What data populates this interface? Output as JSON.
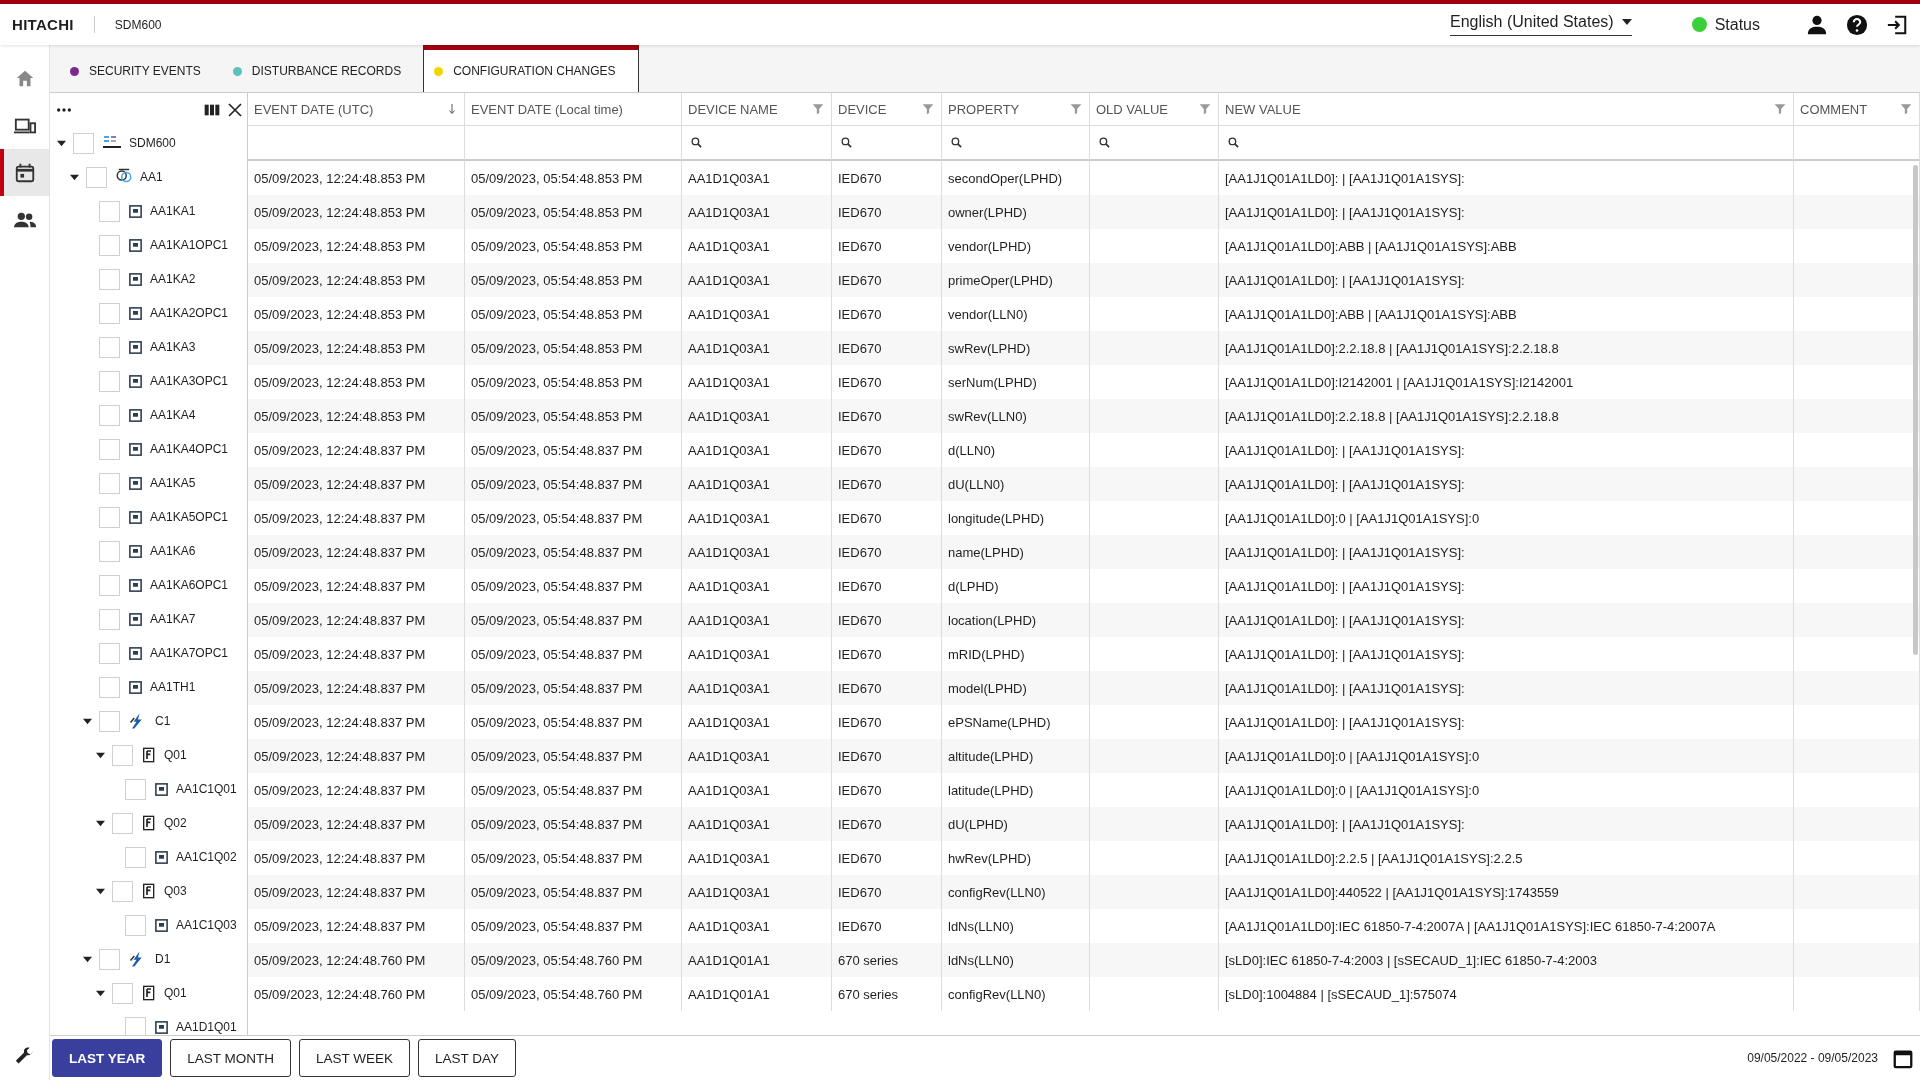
{
  "header": {
    "brand": "HITACHI",
    "product": "SDM600",
    "language": "English (United States)",
    "status": {
      "label": "Status",
      "color": "#3ccf3c"
    }
  },
  "nav": [
    {
      "kind": "home",
      "selected": false
    },
    {
      "kind": "devices",
      "selected": false
    },
    {
      "kind": "calendar",
      "selected": true
    },
    {
      "kind": "users",
      "selected": false
    }
  ],
  "tabs": [
    {
      "label": "SECURITY EVENTS",
      "color": "#7a2a8c",
      "selected": false
    },
    {
      "label": "DISTURBANCE RECORDS",
      "color": "#5cc0bb",
      "selected": false
    },
    {
      "label": "CONFIGURATION CHANGES",
      "color": "#f2d600",
      "selected": true
    }
  ],
  "tree": [
    {
      "label": "SDM600",
      "kind": "root",
      "checked": false,
      "expanded": true,
      "children": [
        {
          "label": "AA1",
          "kind": "substation",
          "checked": false,
          "expanded": true,
          "children": [
            {
              "label": "AA1KA1",
              "kind": "ied",
              "checked": false
            },
            {
              "label": "AA1KA1OPC1",
              "kind": "ied",
              "checked": false
            },
            {
              "label": "AA1KA2",
              "kind": "ied",
              "checked": false
            },
            {
              "label": "AA1KA2OPC1",
              "kind": "ied",
              "checked": false
            },
            {
              "label": "AA1KA3",
              "kind": "ied",
              "checked": false
            },
            {
              "label": "AA1KA3OPC1",
              "kind": "ied",
              "checked": false
            },
            {
              "label": "AA1KA4",
              "kind": "ied",
              "checked": false
            },
            {
              "label": "AA1KA4OPC1",
              "kind": "ied",
              "checked": false
            },
            {
              "label": "AA1KA5",
              "kind": "ied",
              "checked": false
            },
            {
              "label": "AA1KA5OPC1",
              "kind": "ied",
              "checked": false
            },
            {
              "label": "AA1KA6",
              "kind": "ied",
              "checked": false
            },
            {
              "label": "AA1KA6OPC1",
              "kind": "ied",
              "checked": false
            },
            {
              "label": "AA1KA7",
              "kind": "ied",
              "checked": false
            },
            {
              "label": "AA1KA7OPC1",
              "kind": "ied",
              "checked": false
            },
            {
              "label": "AA1TH1",
              "kind": "ied",
              "checked": false
            },
            {
              "label": "C1",
              "kind": "voltage",
              "checked": false,
              "expanded": true,
              "children": [
                {
                  "label": "Q01",
                  "kind": "bay",
                  "checked": false,
                  "expanded": true,
                  "children": [
                    {
                      "label": "AA1C1Q01",
                      "kind": "ied",
                      "checked": false
                    }
                  ]
                },
                {
                  "label": "Q02",
                  "kind": "bay",
                  "checked": false,
                  "expanded": true,
                  "children": [
                    {
                      "label": "AA1C1Q02",
                      "kind": "ied",
                      "checked": false
                    }
                  ]
                },
                {
                  "label": "Q03",
                  "kind": "bay",
                  "checked": false,
                  "expanded": true,
                  "children": [
                    {
                      "label": "AA1C1Q03",
                      "kind": "ied",
                      "checked": false
                    }
                  ]
                }
              ]
            },
            {
              "label": "D1",
              "kind": "voltage",
              "checked": false,
              "expanded": true,
              "children": [
                {
                  "label": "Q01",
                  "kind": "bay",
                  "checked": false,
                  "expanded": true,
                  "children": [
                    {
                      "label": "AA1D1Q01",
                      "kind": "ied",
                      "checked": false
                    }
                  ]
                }
              ]
            }
          ]
        }
      ]
    }
  ],
  "table": {
    "columns": [
      {
        "label": "EVENT DATE (UTC)",
        "sorted": true,
        "filter": false,
        "search": false
      },
      {
        "label": "EVENT DATE (Local time)",
        "sorted": false,
        "filter": false,
        "search": false
      },
      {
        "label": "DEVICE NAME",
        "sorted": false,
        "filter": true,
        "search": true
      },
      {
        "label": "DEVICE",
        "sorted": false,
        "filter": true,
        "search": true
      },
      {
        "label": "PROPERTY",
        "sorted": false,
        "filter": true,
        "search": true
      },
      {
        "label": "OLD VALUE",
        "sorted": false,
        "filter": true,
        "search": true
      },
      {
        "label": "NEW VALUE",
        "sorted": false,
        "filter": true,
        "search": true
      },
      {
        "label": "COMMENT",
        "sorted": false,
        "filter": true,
        "search": false
      }
    ],
    "rows": [
      {
        "utc": "05/09/2023, 12:24:48.853 PM",
        "local": "05/09/2023, 05:54:48.853 PM",
        "device_name": "AA1D1Q03A1",
        "device": "IED670",
        "property": "secondOper(LPHD)",
        "new_value": "[AA1J1Q01A1LD0]: | [AA1J1Q01A1SYS]:"
      },
      {
        "utc": "05/09/2023, 12:24:48.853 PM",
        "local": "05/09/2023, 05:54:48.853 PM",
        "device_name": "AA1D1Q03A1",
        "device": "IED670",
        "property": "owner(LPHD)",
        "new_value": "[AA1J1Q01A1LD0]: | [AA1J1Q01A1SYS]:"
      },
      {
        "utc": "05/09/2023, 12:24:48.853 PM",
        "local": "05/09/2023, 05:54:48.853 PM",
        "device_name": "AA1D1Q03A1",
        "device": "IED670",
        "property": "vendor(LPHD)",
        "new_value": "[AA1J1Q01A1LD0]:ABB | [AA1J1Q01A1SYS]:ABB"
      },
      {
        "utc": "05/09/2023, 12:24:48.853 PM",
        "local": "05/09/2023, 05:54:48.853 PM",
        "device_name": "AA1D1Q03A1",
        "device": "IED670",
        "property": "primeOper(LPHD)",
        "new_value": "[AA1J1Q01A1LD0]: | [AA1J1Q01A1SYS]:"
      },
      {
        "utc": "05/09/2023, 12:24:48.853 PM",
        "local": "05/09/2023, 05:54:48.853 PM",
        "device_name": "AA1D1Q03A1",
        "device": "IED670",
        "property": "vendor(LLN0)",
        "new_value": "[AA1J1Q01A1LD0]:ABB | [AA1J1Q01A1SYS]:ABB"
      },
      {
        "utc": "05/09/2023, 12:24:48.853 PM",
        "local": "05/09/2023, 05:54:48.853 PM",
        "device_name": "AA1D1Q03A1",
        "device": "IED670",
        "property": "swRev(LPHD)",
        "new_value": "[AA1J1Q01A1LD0]:2.2.18.8 | [AA1J1Q01A1SYS]:2.2.18.8"
      },
      {
        "utc": "05/09/2023, 12:24:48.853 PM",
        "local": "05/09/2023, 05:54:48.853 PM",
        "device_name": "AA1D1Q03A1",
        "device": "IED670",
        "property": "serNum(LPHD)",
        "new_value": "[AA1J1Q01A1LD0]:I2142001 | [AA1J1Q01A1SYS]:I2142001"
      },
      {
        "utc": "05/09/2023, 12:24:48.853 PM",
        "local": "05/09/2023, 05:54:48.853 PM",
        "device_name": "AA1D1Q03A1",
        "device": "IED670",
        "property": "swRev(LLN0)",
        "new_value": "[AA1J1Q01A1LD0]:2.2.18.8 | [AA1J1Q01A1SYS]:2.2.18.8"
      },
      {
        "utc": "05/09/2023, 12:24:48.837 PM",
        "local": "05/09/2023, 05:54:48.837 PM",
        "device_name": "AA1D1Q03A1",
        "device": "IED670",
        "property": "d(LLN0)",
        "new_value": "[AA1J1Q01A1LD0]: | [AA1J1Q01A1SYS]:"
      },
      {
        "utc": "05/09/2023, 12:24:48.837 PM",
        "local": "05/09/2023, 05:54:48.837 PM",
        "device_name": "AA1D1Q03A1",
        "device": "IED670",
        "property": "dU(LLN0)",
        "new_value": "[AA1J1Q01A1LD0]: | [AA1J1Q01A1SYS]:"
      },
      {
        "utc": "05/09/2023, 12:24:48.837 PM",
        "local": "05/09/2023, 05:54:48.837 PM",
        "device_name": "AA1D1Q03A1",
        "device": "IED670",
        "property": "longitude(LPHD)",
        "new_value": "[AA1J1Q01A1LD0]:0 | [AA1J1Q01A1SYS]:0"
      },
      {
        "utc": "05/09/2023, 12:24:48.837 PM",
        "local": "05/09/2023, 05:54:48.837 PM",
        "device_name": "AA1D1Q03A1",
        "device": "IED670",
        "property": "name(LPHD)",
        "new_value": "[AA1J1Q01A1LD0]: | [AA1J1Q01A1SYS]:"
      },
      {
        "utc": "05/09/2023, 12:24:48.837 PM",
        "local": "05/09/2023, 05:54:48.837 PM",
        "device_name": "AA1D1Q03A1",
        "device": "IED670",
        "property": "d(LPHD)",
        "new_value": "[AA1J1Q01A1LD0]: | [AA1J1Q01A1SYS]:"
      },
      {
        "utc": "05/09/2023, 12:24:48.837 PM",
        "local": "05/09/2023, 05:54:48.837 PM",
        "device_name": "AA1D1Q03A1",
        "device": "IED670",
        "property": "location(LPHD)",
        "new_value": "[AA1J1Q01A1LD0]: | [AA1J1Q01A1SYS]:"
      },
      {
        "utc": "05/09/2023, 12:24:48.837 PM",
        "local": "05/09/2023, 05:54:48.837 PM",
        "device_name": "AA1D1Q03A1",
        "device": "IED670",
        "property": "mRID(LPHD)",
        "new_value": "[AA1J1Q01A1LD0]: | [AA1J1Q01A1SYS]:"
      },
      {
        "utc": "05/09/2023, 12:24:48.837 PM",
        "local": "05/09/2023, 05:54:48.837 PM",
        "device_name": "AA1D1Q03A1",
        "device": "IED670",
        "property": "model(LPHD)",
        "new_value": "[AA1J1Q01A1LD0]: | [AA1J1Q01A1SYS]:"
      },
      {
        "utc": "05/09/2023, 12:24:48.837 PM",
        "local": "05/09/2023, 05:54:48.837 PM",
        "device_name": "AA1D1Q03A1",
        "device": "IED670",
        "property": "ePSName(LPHD)",
        "new_value": "[AA1J1Q01A1LD0]: | [AA1J1Q01A1SYS]:"
      },
      {
        "utc": "05/09/2023, 12:24:48.837 PM",
        "local": "05/09/2023, 05:54:48.837 PM",
        "device_name": "AA1D1Q03A1",
        "device": "IED670",
        "property": "altitude(LPHD)",
        "new_value": "[AA1J1Q01A1LD0]:0 | [AA1J1Q01A1SYS]:0"
      },
      {
        "utc": "05/09/2023, 12:24:48.837 PM",
        "local": "05/09/2023, 05:54:48.837 PM",
        "device_name": "AA1D1Q03A1",
        "device": "IED670",
        "property": "latitude(LPHD)",
        "new_value": "[AA1J1Q01A1LD0]:0 | [AA1J1Q01A1SYS]:0"
      },
      {
        "utc": "05/09/2023, 12:24:48.837 PM",
        "local": "05/09/2023, 05:54:48.837 PM",
        "device_name": "AA1D1Q03A1",
        "device": "IED670",
        "property": "dU(LPHD)",
        "new_value": "[AA1J1Q01A1LD0]: | [AA1J1Q01A1SYS]:"
      },
      {
        "utc": "05/09/2023, 12:24:48.837 PM",
        "local": "05/09/2023, 05:54:48.837 PM",
        "device_name": "AA1D1Q03A1",
        "device": "IED670",
        "property": "hwRev(LPHD)",
        "new_value": "[AA1J1Q01A1LD0]:2.2.5 | [AA1J1Q01A1SYS]:2.2.5"
      },
      {
        "utc": "05/09/2023, 12:24:48.837 PM",
        "local": "05/09/2023, 05:54:48.837 PM",
        "device_name": "AA1D1Q03A1",
        "device": "IED670",
        "property": "configRev(LLN0)",
        "new_value": "[AA1J1Q01A1LD0]:440522 | [AA1J1Q01A1SYS]:1743559"
      },
      {
        "utc": "05/09/2023, 12:24:48.837 PM",
        "local": "05/09/2023, 05:54:48.837 PM",
        "device_name": "AA1D1Q03A1",
        "device": "IED670",
        "property": "ldNs(LLN0)",
        "new_value": "[AA1J1Q01A1LD0]:IEC 61850-7-4:2007A | [AA1J1Q01A1SYS]:IEC 61850-7-4:2007A"
      },
      {
        "utc": "05/09/2023, 12:24:48.760 PM",
        "local": "05/09/2023, 05:54:48.760 PM",
        "device_name": "AA1D1Q01A1",
        "device": "670 series",
        "property": "ldNs(LLN0)",
        "new_value": "[sLD0]:IEC 61850-7-4:2003 | [sSECAUD_1]:IEC 61850-7-4:2003"
      },
      {
        "utc": "05/09/2023, 12:24:48.760 PM",
        "local": "05/09/2023, 05:54:48.760 PM",
        "device_name": "AA1D1Q01A1",
        "device": "670 series",
        "property": "configRev(LLN0)",
        "new_value": "[sLD0]:1004884 | [sSECAUD_1]:575074"
      }
    ]
  },
  "footer": {
    "ranges": [
      {
        "label": "LAST YEAR",
        "selected": true
      },
      {
        "label": "LAST MONTH",
        "selected": false
      },
      {
        "label": "LAST WEEK",
        "selected": false
      },
      {
        "label": "LAST DAY",
        "selected": false
      }
    ],
    "date_range": "09/05/2022 - 09/05/2023"
  }
}
